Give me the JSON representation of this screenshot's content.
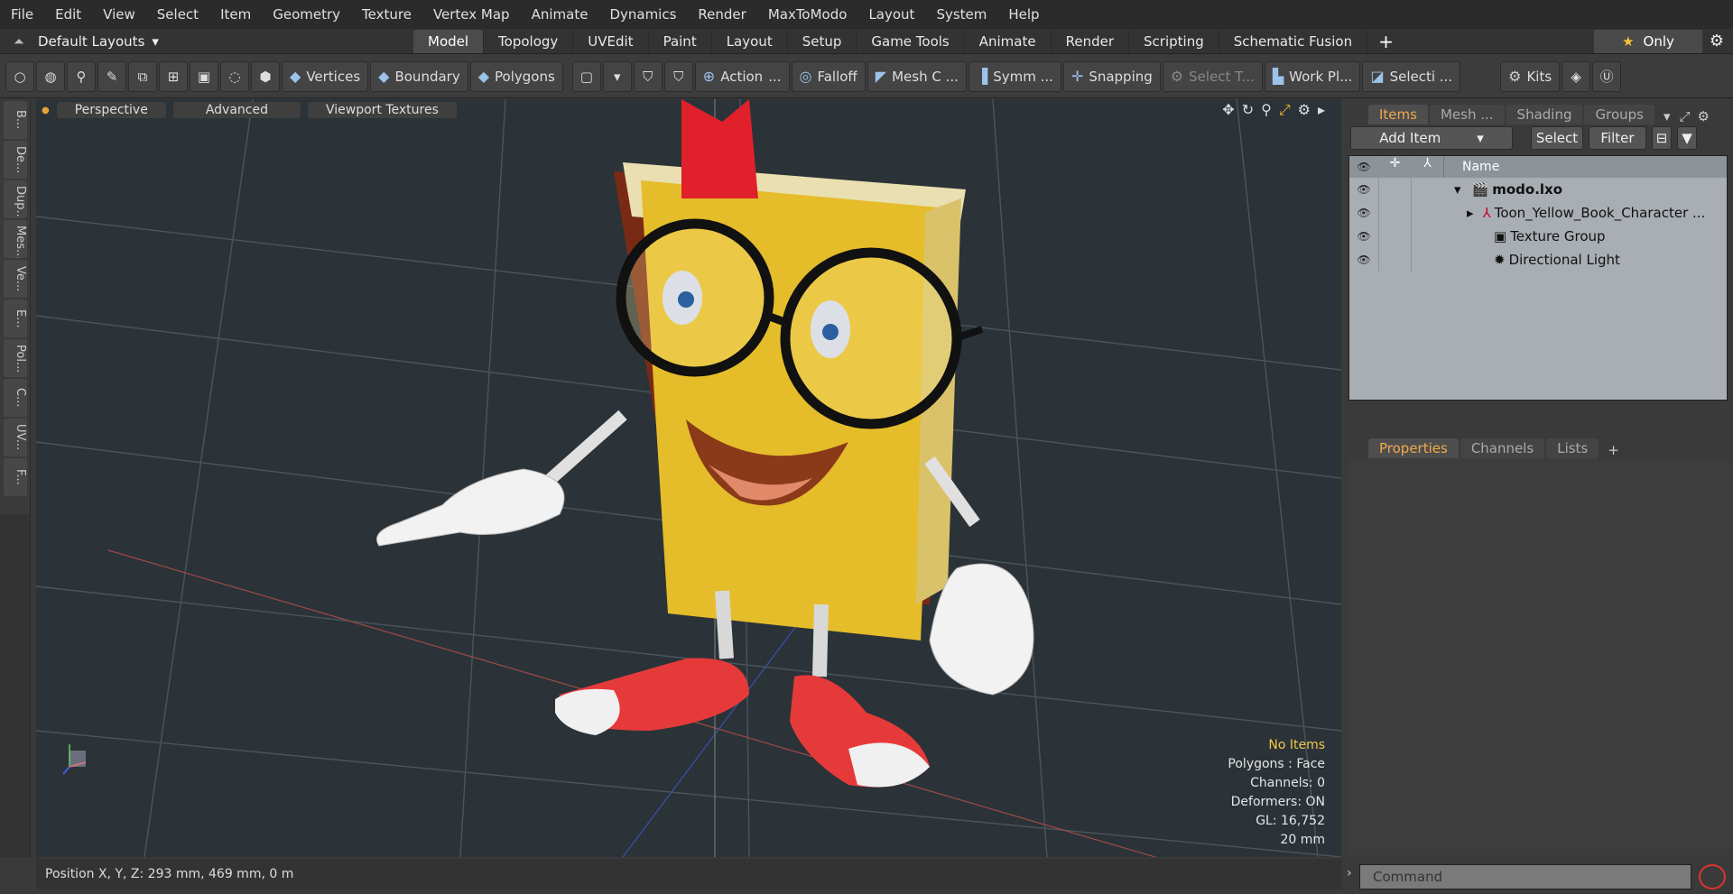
{
  "menu": [
    "File",
    "Edit",
    "View",
    "Select",
    "Item",
    "Geometry",
    "Texture",
    "Vertex Map",
    "Animate",
    "Dynamics",
    "Render",
    "MaxToModo",
    "Layout",
    "System",
    "Help"
  ],
  "layout": {
    "dropdown": "Default Layouts"
  },
  "tabs": [
    "Model",
    "Topology",
    "UVEdit",
    "Paint",
    "Layout",
    "Setup",
    "Game Tools",
    "Animate",
    "Render",
    "Scripting",
    "Schematic Fusion"
  ],
  "only_label": "Only",
  "toolbar": {
    "vertices": "Vertices",
    "boundary": "Boundary",
    "polygons": "Polygons",
    "action": "Action",
    "action_more": "...",
    "falloff": "Falloff",
    "mesh": "Mesh C ...",
    "symm": "Symm ...",
    "snapping": "Snapping",
    "select_t": "Select T...",
    "workpl": "Work Pl...",
    "selecti": "Selecti ...",
    "kits": "Kits"
  },
  "left_tabs": [
    "B...",
    "De...",
    "Dup...",
    "Mes...",
    "Ve...",
    "E...",
    "Pol...",
    "C...",
    "UV...",
    "F..."
  ],
  "viewport": {
    "perspective": "Perspective",
    "advanced": "Advanced",
    "textures": "Viewport Textures",
    "info": [
      "No Items",
      "Polygons : Face",
      "Channels: 0",
      "Deformers: ON",
      "GL: 16,752",
      "20 mm"
    ]
  },
  "status": "Position X, Y, Z:   293 mm, 469 mm, 0 m",
  "panel": {
    "tabs": [
      "Items",
      "Mesh ...",
      "Shading",
      "Groups"
    ],
    "add_item": "Add Item",
    "select": "Select",
    "filter": "Filter",
    "name_header": "Name",
    "items": [
      "modo.lxo",
      "Toon_Yellow_Book_Character ...",
      "Texture Group",
      "Directional Light"
    ],
    "prop_tabs": [
      "Properties",
      "Channels",
      "Lists"
    ],
    "command": "Command"
  }
}
